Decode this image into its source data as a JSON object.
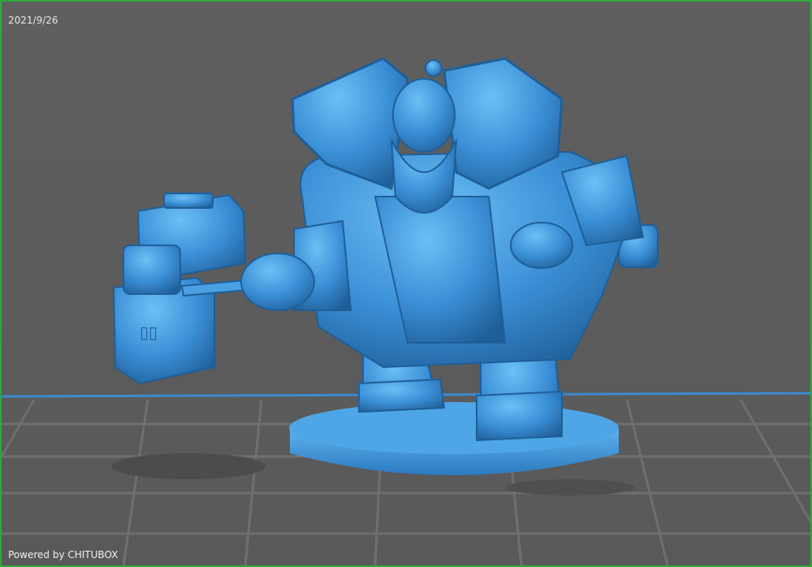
{
  "viewport": {
    "date": "2021/9/26",
    "footer": "Powered by CHITUBOX"
  },
  "model": {
    "description": "dwarf-warrior-miniature",
    "color": "#3b8fd6",
    "highlight": "#6cc0f5",
    "shadow": "#1f5f99"
  },
  "build_plate": {
    "grid_color": "#6c6c6c",
    "edge_color": "#3d89d0"
  },
  "frame": {
    "border_color": "#2fa83a"
  }
}
